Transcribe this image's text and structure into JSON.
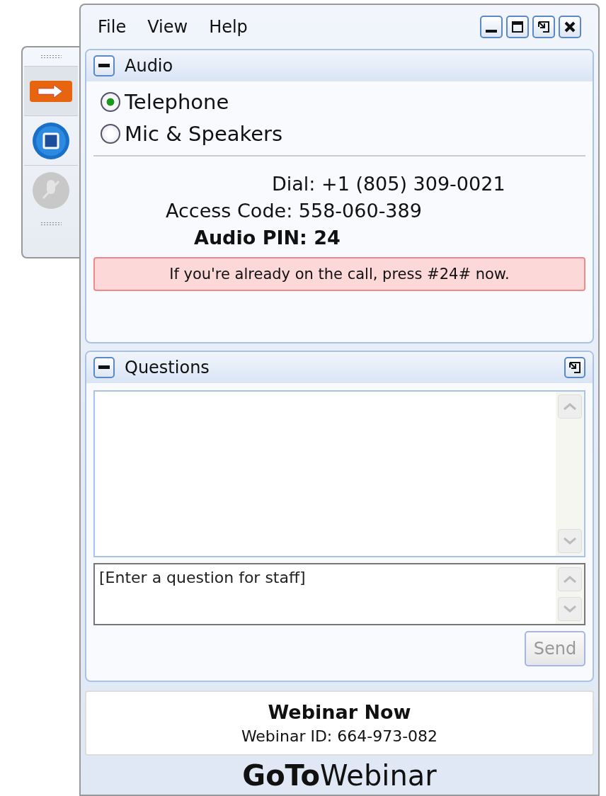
{
  "toolbar": {
    "items": [
      {
        "kind": "show",
        "disabled": false
      },
      {
        "kind": "stop",
        "disabled": false
      },
      {
        "kind": "mic",
        "disabled": true
      }
    ]
  },
  "menu": [
    "File",
    "View",
    "Help"
  ],
  "audio": {
    "title": "Audio",
    "expanded": true,
    "options": [
      {
        "label": "Telephone",
        "selected": true
      },
      {
        "label": "Mic & Speakers",
        "selected": false
      }
    ],
    "dial": "Dial: +1 (805) 309-0021",
    "access_code": "Access Code: 558-060-389",
    "pin": "Audio PIN: 24",
    "notice": "If you're already on the call, press #24# now."
  },
  "questions": {
    "title": "Questions",
    "expanded": true,
    "input": {
      "placeholder": "[Enter a question for staff]"
    },
    "send": {
      "label": "Send",
      "disabled": true
    }
  },
  "footer": {
    "title": "Webinar Now",
    "webinar_id": "Webinar ID: 664-973-082"
  },
  "brand": "**GoTo**Webinar"
}
